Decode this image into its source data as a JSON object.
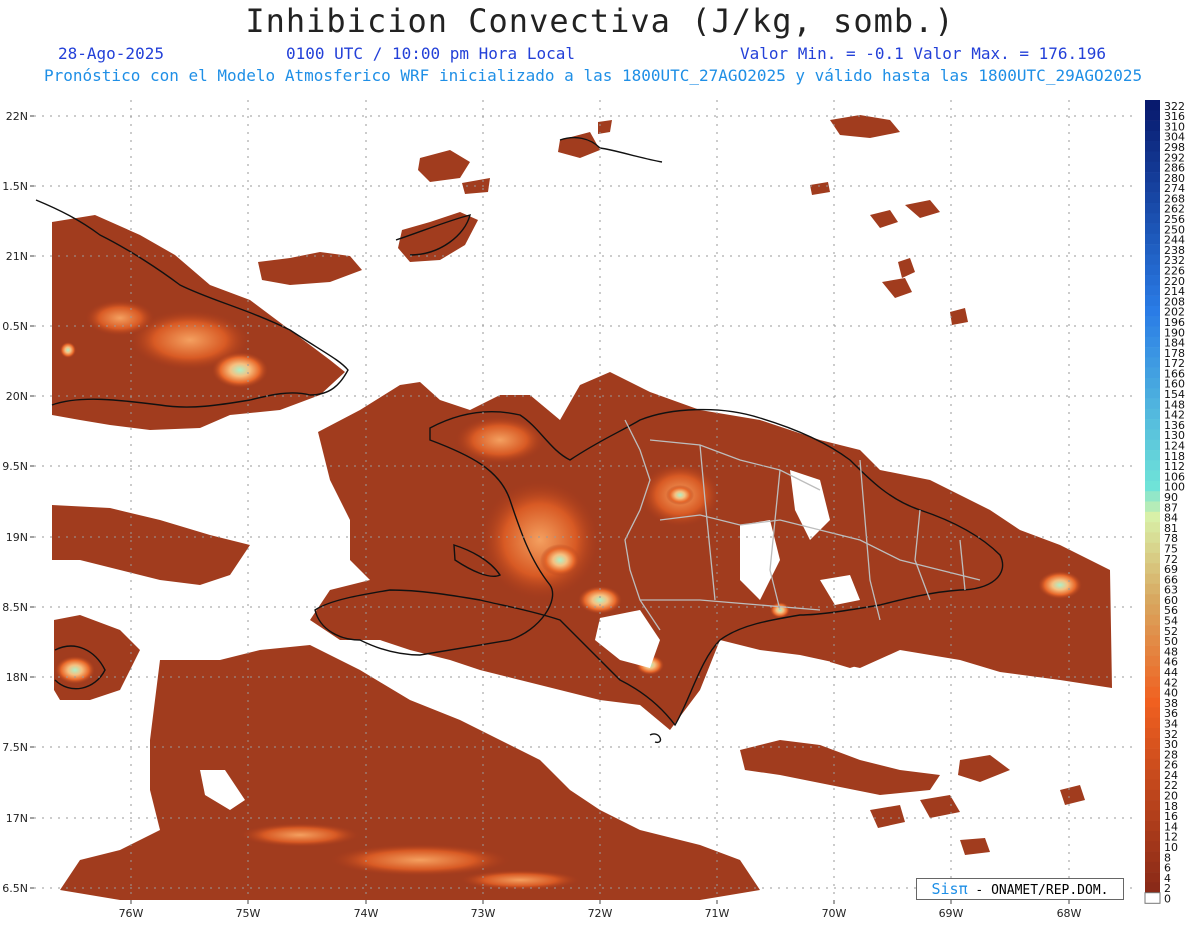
{
  "header": {
    "title": "Inhibicion Convectiva (J/kg, somb.)",
    "date": "28-Ago-2025",
    "time": "0100 UTC / 10:00 pm Hora Local",
    "range": "Valor Min. = -0.1  Valor Max. = 176.196",
    "forecast": "Pronóstico con el Modelo Atmosferico WRF inicializado a las 1800UTC_27AGO2025 y válido hasta las  1800UTC_29AGO2025"
  },
  "map": {
    "lat_labels": [
      "22N",
      "1.5N",
      "21N",
      "0.5N",
      "20N",
      "9.5N",
      "19N",
      "8.5N",
      "18N",
      "7.5N",
      "17N",
      "6.5N"
    ],
    "lon_labels": [
      "76W",
      "75W",
      "74W",
      "73W",
      "72W",
      "71W",
      "70W",
      "69W",
      "68W"
    ]
  },
  "legend": {
    "values": [
      "322",
      "316",
      "310",
      "304",
      "298",
      "292",
      "286",
      "280",
      "274",
      "268",
      "262",
      "256",
      "250",
      "244",
      "238",
      "232",
      "226",
      "220",
      "214",
      "208",
      "202",
      "196",
      "190",
      "184",
      "178",
      "172",
      "166",
      "160",
      "154",
      "148",
      "142",
      "136",
      "130",
      "124",
      "118",
      "112",
      "106",
      "100",
      "90",
      "87",
      "84",
      "81",
      "78",
      "75",
      "72",
      "69",
      "66",
      "63",
      "60",
      "56",
      "54",
      "52",
      "50",
      "48",
      "46",
      "44",
      "42",
      "40",
      "38",
      "36",
      "34",
      "32",
      "30",
      "28",
      "26",
      "24",
      "22",
      "20",
      "18",
      "16",
      "14",
      "12",
      "10",
      "8",
      "6",
      "4",
      "2",
      "0"
    ],
    "colors": {
      "top": "#081a6e",
      "blue_mid": "#2a7ce6",
      "cyan": "#6fe3d8",
      "pale_green": "#d8f0a8",
      "tan": "#d8a860",
      "orange": "#f06020",
      "brown": "#8a2a18",
      "zero": "#ffffff"
    }
  },
  "credit": {
    "logo": "Sisπ",
    "text": " - ONAMET/REP.DOM."
  }
}
